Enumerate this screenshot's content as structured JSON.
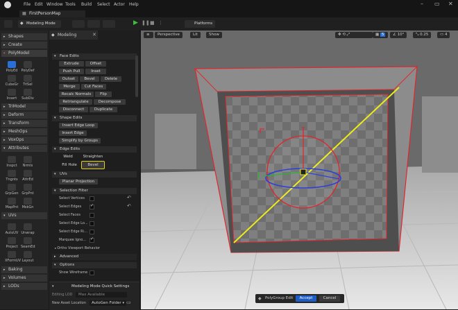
{
  "menu": [
    "File",
    "Edit",
    "Window",
    "Tools",
    "Build",
    "Select",
    "Actor",
    "Help"
  ],
  "map_tab": "FirstPersonMap",
  "toolbar": {
    "mode": "Modeling Mode",
    "platforms": "Platforms"
  },
  "palette": {
    "categories_top": [
      "Shapes",
      "Create",
      "PolyModel"
    ],
    "polymodel_tools": [
      [
        "PolyEd",
        "PolyDef"
      ],
      [
        "CubeGr",
        "TriSel"
      ],
      [
        "Insert",
        "SubDiv"
      ]
    ],
    "categories_mid": [
      "TriModel",
      "Deform",
      "Transform",
      "MeshOps",
      "VoxOps",
      "Attributes"
    ],
    "attr_tools": [
      [
        "Inspct",
        "Nrmls"
      ],
      [
        "Tngnts",
        "AttrEd"
      ],
      [
        "GrpGen",
        "GrpPnt"
      ],
      [
        "MapPnt",
        "MskGn"
      ]
    ],
    "uvs": "UVs",
    "uv_tools": [
      [
        "AutoUV",
        "Unwrap"
      ],
      [
        "Project",
        "SeamEd"
      ],
      [
        "XFormUV",
        "Layout"
      ]
    ],
    "categories_bottom": [
      "Baking",
      "Volumes",
      "LODs"
    ]
  },
  "panel": {
    "tab": "Modeling",
    "face_edits": {
      "title": "Face Edits",
      "rows": [
        [
          "Extrude",
          "Offset"
        ],
        [
          "Push Pull",
          "Inset"
        ],
        [
          "Outset",
          "Bevel",
          "Delete"
        ],
        [
          "Merge",
          "Cut Faces"
        ],
        [
          "Recalc Normals",
          "Flip"
        ],
        [
          "Retriangulate",
          "Decompose"
        ],
        [
          "Disconnect",
          "Duplicate"
        ]
      ]
    },
    "shape_edits": {
      "title": "Shape Edits",
      "buttons": [
        "Insert Edge Loop",
        "Insert Edge",
        "Simplify by Groups"
      ]
    },
    "edge_edits": {
      "title": "Edge Edits",
      "rows": [
        [
          "Weld",
          "Straighten"
        ],
        [
          "Fill Hole",
          "Bevel"
        ]
      ]
    },
    "uvs": {
      "title": "UVs",
      "button": "Planar Projection"
    },
    "selection_filter": {
      "title": "Selection Filter",
      "items": [
        {
          "label": "Select Vertices",
          "on": false
        },
        {
          "label": "Select Edges",
          "on": true
        },
        {
          "label": "Select Faces",
          "on": false
        },
        {
          "label": "Select Edge Lo...",
          "on": false
        },
        {
          "label": "Select Edge Ri...",
          "on": false
        },
        {
          "label": "Marquee Igno...",
          "on": true
        }
      ],
      "ortho": "Ortho Viewport Behavior"
    },
    "advanced": "Advanced",
    "options": {
      "title": "Options",
      "item": "Show Wireframe"
    },
    "quick_settings": {
      "title": "Modeling Mode Quick Settings",
      "editing_lod_label": "Editing LOD",
      "editing_lod_value": "Max Available",
      "new_asset_label": "New Asset Location",
      "new_asset_value": "AutoGen Folder"
    }
  },
  "viewport": {
    "perspective": "Perspective",
    "lit": "Lit",
    "show": "Show",
    "snap_value": "5",
    "angle_value": "10°",
    "scale_value": "0.25",
    "camera_value": "4"
  },
  "bottombar": {
    "label": "PolyGroup Edit",
    "accept": "Accept",
    "cancel": "Cancel"
  },
  "colors": {
    "accent_select": "#e8d31b",
    "accept_blue": "#1e5cc6",
    "edge_red": "#e0262d",
    "gizmo_yellow": "#ecec1a"
  }
}
